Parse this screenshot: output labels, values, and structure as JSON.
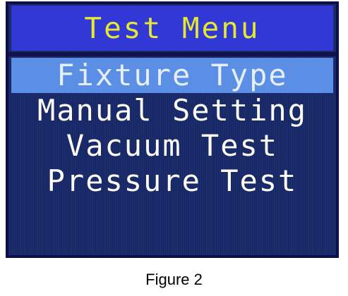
{
  "screen": {
    "title": "Test Menu",
    "menu_items": [
      {
        "label": "Fixture Type",
        "selected": true
      },
      {
        "label": "Manual Setting",
        "selected": false
      },
      {
        "label": "Vacuum Test",
        "selected": false
      },
      {
        "label": "Pressure Test",
        "selected": false
      }
    ],
    "colors": {
      "title_bar": "#3238d6",
      "title_text": "#e4e733",
      "background": "#1b2d6f",
      "selected_highlight": "#5b8fe6",
      "menu_text": "#ffffff"
    }
  },
  "caption": "Figure 2"
}
